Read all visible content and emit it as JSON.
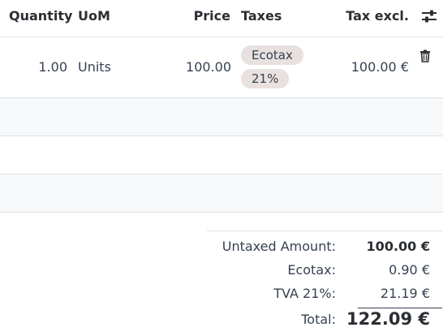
{
  "table": {
    "headers": {
      "quantity": "Quantity",
      "uom": "UoM",
      "price": "Price",
      "taxes": "Taxes",
      "tax_excl": "Tax excl."
    },
    "rows": [
      {
        "quantity": "1.00",
        "uom": "Units",
        "price": "100.00",
        "taxes": [
          "Ecotax",
          "21%"
        ],
        "tax_excl": "100.00 €"
      }
    ],
    "icons": {
      "settings": "sliders-icon",
      "delete": "trash-icon"
    }
  },
  "totals": {
    "untaxed_label": "Untaxed Amount:",
    "untaxed_value": "100.00 €",
    "ecotax_label": "Ecotax:",
    "ecotax_value": "0.90 €",
    "tva_label": "TVA 21%:",
    "tva_value": "21.19 €",
    "total_label": "Total:",
    "total_value": "122.09 €"
  },
  "colors": {
    "badge_bg": "#e8e1df",
    "row_alt_bg": "#f8f9fa",
    "border": "#dee2e6",
    "text": "#374151"
  }
}
